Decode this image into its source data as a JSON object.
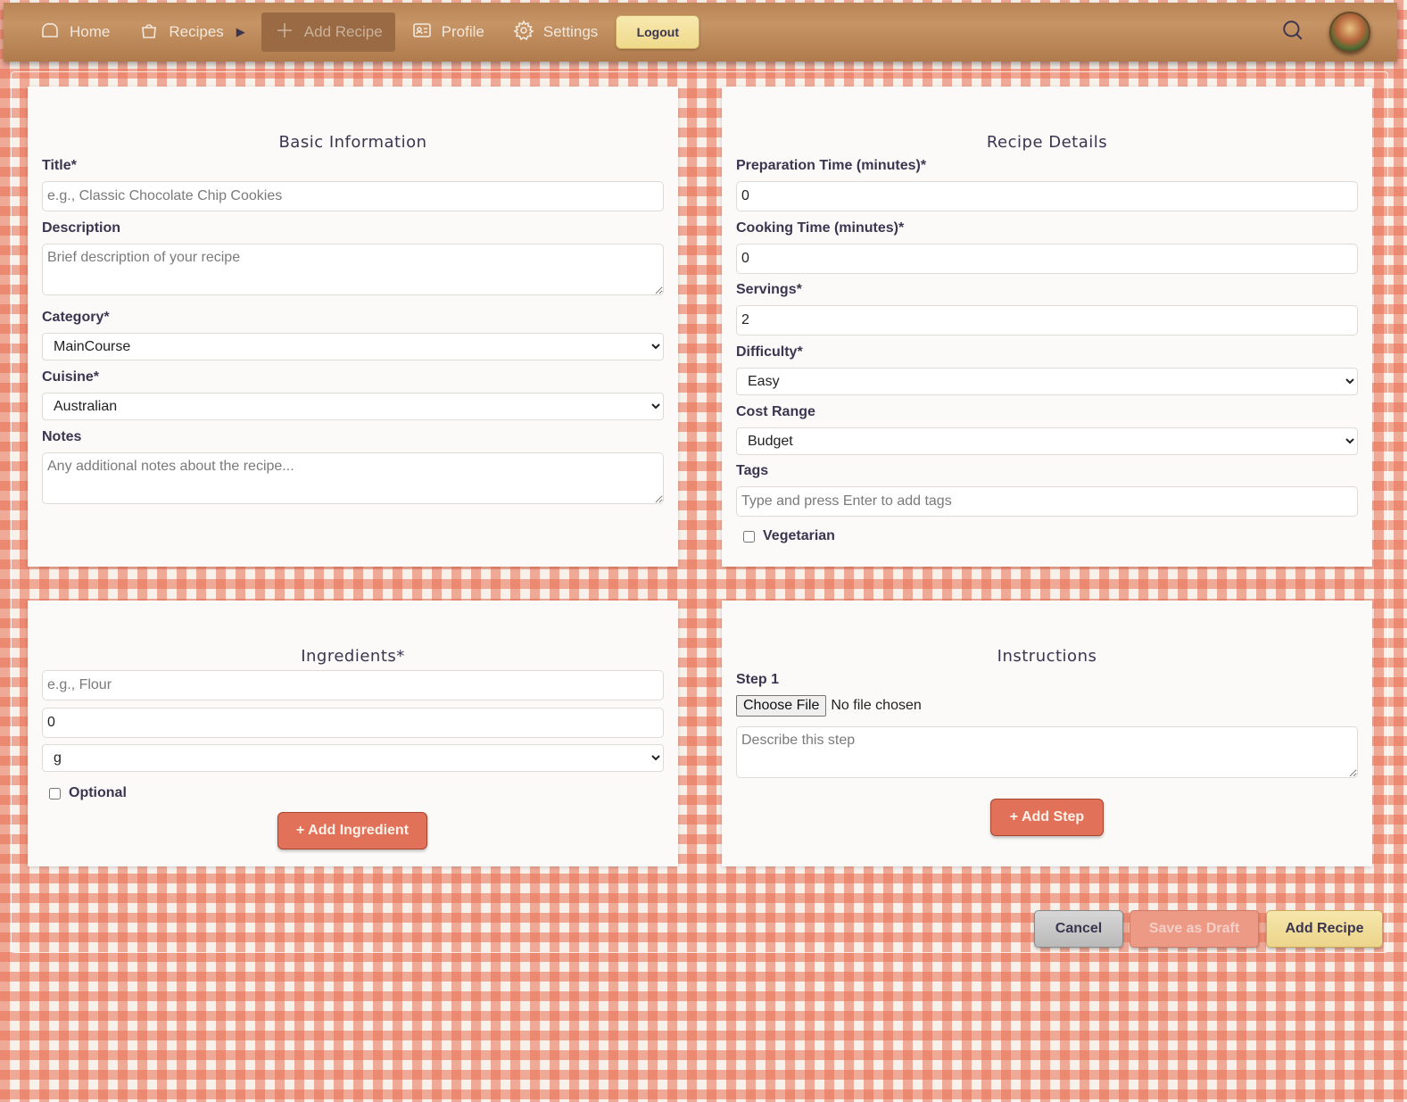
{
  "nav": {
    "home": "Home",
    "recipes": "Recipes",
    "add_recipe": "Add Recipe",
    "profile": "Profile",
    "settings": "Settings",
    "logout": "Logout"
  },
  "basic": {
    "title": "Basic Information",
    "title_label": "Title*",
    "title_placeholder": "e.g., Classic Chocolate Chip Cookies",
    "description_label": "Description",
    "description_placeholder": "Brief description of your recipe",
    "category_label": "Category*",
    "category_value": "MainCourse",
    "cuisine_label": "Cuisine*",
    "cuisine_value": "Australian",
    "notes_label": "Notes",
    "notes_placeholder": "Any additional notes about the recipe..."
  },
  "details": {
    "title": "Recipe Details",
    "prep_label": "Preparation Time (minutes)*",
    "prep_value": "0",
    "cook_label": "Cooking Time (minutes)*",
    "cook_value": "0",
    "servings_label": "Servings*",
    "servings_value": "2",
    "difficulty_label": "Difficulty*",
    "difficulty_value": "Easy",
    "cost_label": "Cost Range",
    "cost_value": "Budget",
    "tags_label": "Tags",
    "tags_placeholder": "Type and press Enter to add tags",
    "vegetarian_label": "Vegetarian"
  },
  "ingredients": {
    "title": "Ingredients*",
    "name_placeholder": "e.g., Flour",
    "amount_value": "0",
    "unit_value": "g",
    "optional_label": "Optional",
    "add_button": "+ Add Ingredient"
  },
  "instructions": {
    "title": "Instructions",
    "step_label": "Step 1",
    "choose_file": "Choose File",
    "no_file": "No file chosen",
    "step_placeholder": "Describe this step",
    "add_button": "+ Add Step"
  },
  "actions": {
    "cancel": "Cancel",
    "save_draft": "Save as Draft",
    "add_recipe": "Add Recipe"
  },
  "colors": {
    "accent": "#e27159",
    "nav_wood": "#c69465",
    "gold_button": "#efd98a",
    "text": "#3b3550"
  }
}
